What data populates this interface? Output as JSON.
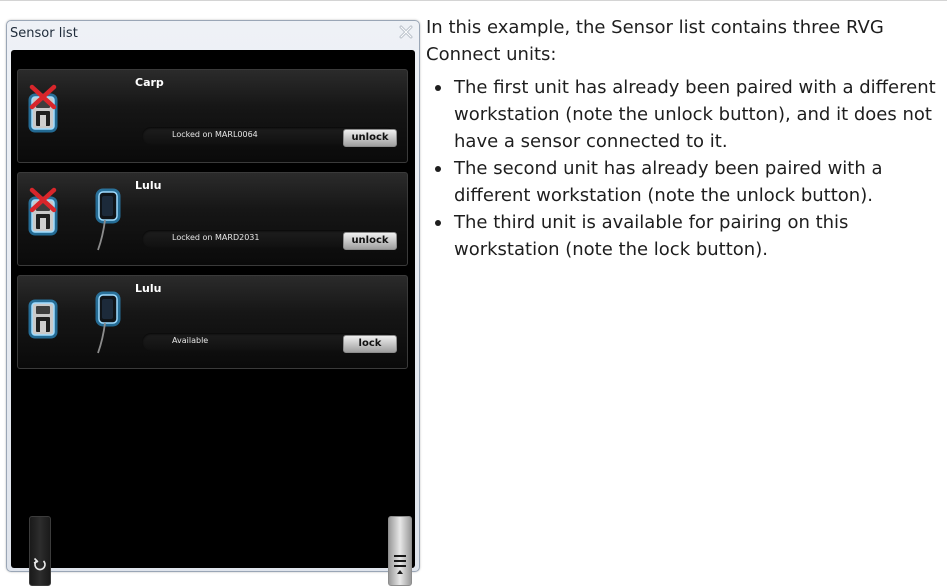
{
  "sensor_window": {
    "title": "Sensor list",
    "units": [
      {
        "name": "Carp",
        "status": "Locked on MARL0064",
        "button_label": "unlock",
        "unit_icon": "rvg-unit-disabled-icon",
        "sensor_connected": false
      },
      {
        "name": "Lulu",
        "status": "Locked on MARD2031",
        "button_label": "unlock",
        "unit_icon": "rvg-unit-disabled-icon",
        "sensor_connected": true
      },
      {
        "name": "Lulu",
        "status": "Available",
        "button_label": "lock",
        "unit_icon": "rvg-unit-icon",
        "sensor_connected": true
      }
    ],
    "icons": {
      "close": "close-icon",
      "refresh": "refresh-icon",
      "menu": "menu-icon"
    }
  },
  "description": {
    "intro": "In this example, the Sensor list contains three RVG Connect units:",
    "bullets": [
      "The first unit has already been paired with a different workstation (note the unlock button), and it does not have a sensor connected to it.",
      "The second unit has already been paired with a different workstation (note the unlock button).",
      "The third unit is available for pairing on this workstation (note the lock button)."
    ]
  },
  "colors": {
    "panel_background": "#000000",
    "accent_glow": "#33b5ff",
    "cross_red": "#d8262b",
    "window_border": "#9aa6b6"
  }
}
